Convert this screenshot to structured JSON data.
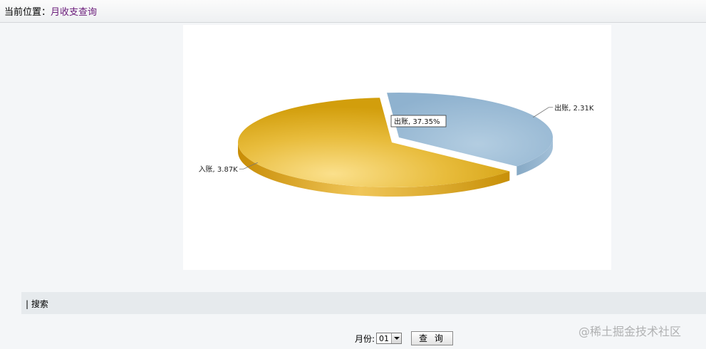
{
  "breadcrumb": {
    "label": "当前位置：",
    "current": "月收支查询"
  },
  "chart_data": {
    "type": "pie",
    "title": "",
    "labels": [
      "出账",
      "入账"
    ],
    "values": [
      2.31,
      3.87
    ],
    "value_unit": "K",
    "value_labels": [
      "出账, 2.31K",
      "入账, 3.87K"
    ],
    "tooltip": "出账, 37.35%",
    "colors": {
      "出账": "#97b8d3",
      "入账": "#e0a817"
    },
    "style": "3d"
  },
  "search": {
    "title": "| 搜索",
    "month_label": "月份:",
    "month_value": "01",
    "query_button": "查 询"
  },
  "watermark": "@稀土掘金技术社区"
}
